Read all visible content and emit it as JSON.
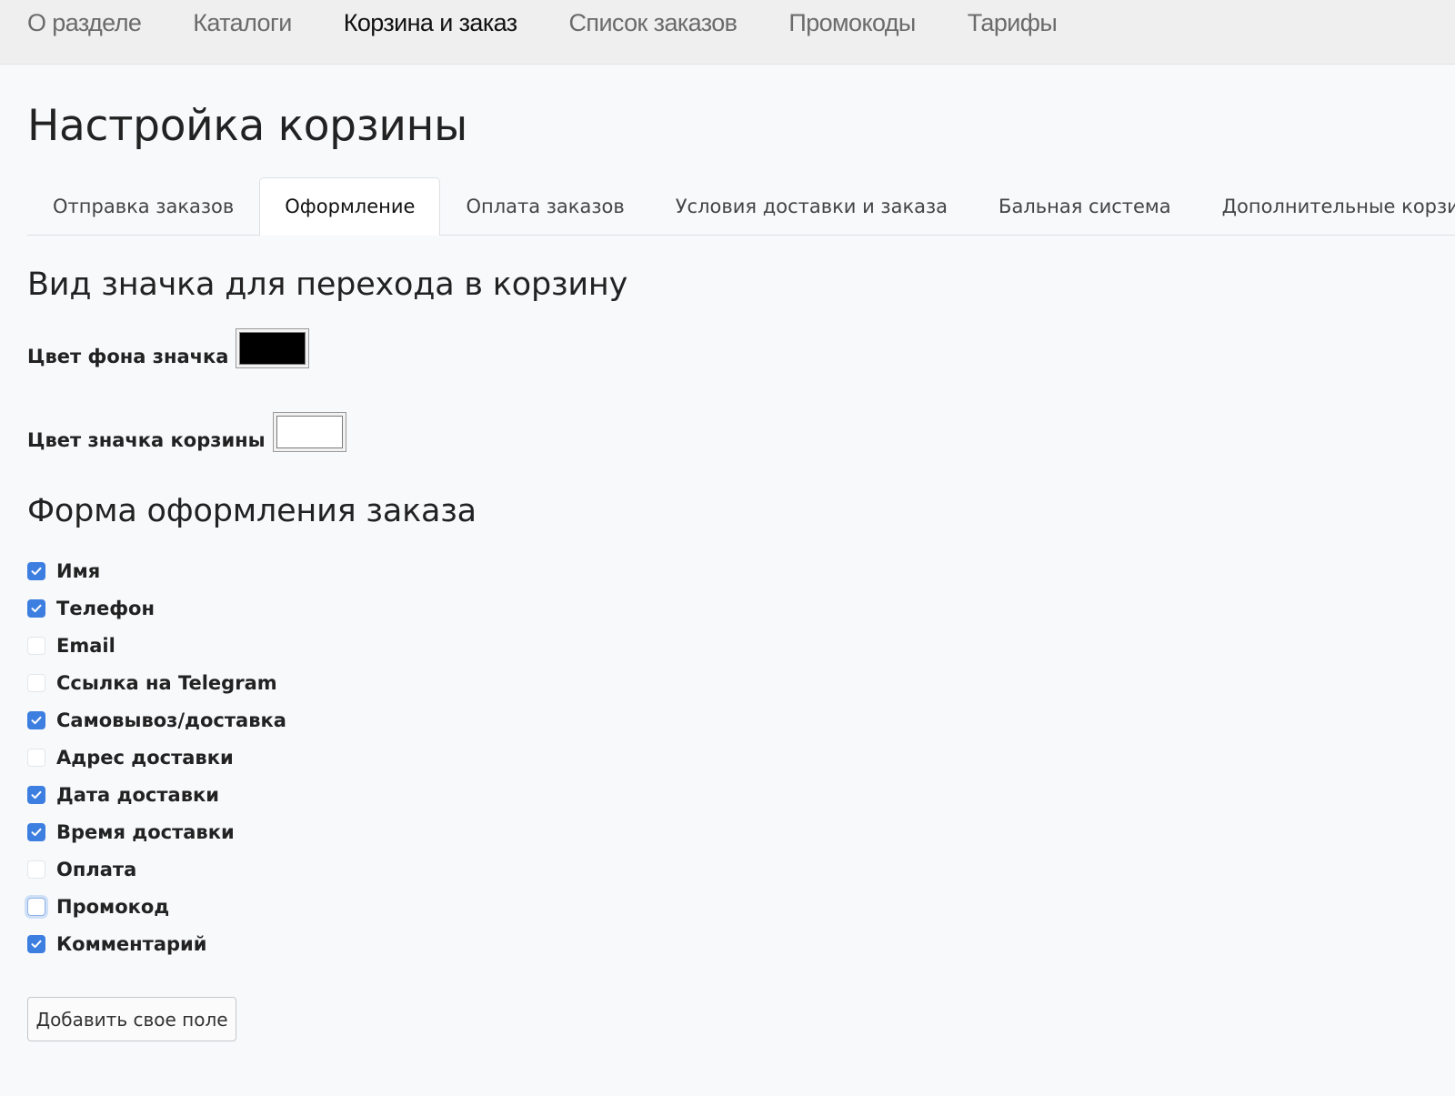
{
  "topnav": {
    "items": [
      {
        "label": "О разделе",
        "active": false
      },
      {
        "label": "Каталоги",
        "active": false
      },
      {
        "label": "Корзина и заказ",
        "active": true
      },
      {
        "label": "Список заказов",
        "active": false
      },
      {
        "label": "Промокоды",
        "active": false
      },
      {
        "label": "Тарифы",
        "active": false
      }
    ]
  },
  "page": {
    "title": "Настройка корзины"
  },
  "tabs": [
    {
      "label": "Отправка заказов",
      "active": false
    },
    {
      "label": "Оформление",
      "active": true
    },
    {
      "label": "Оплата заказов",
      "active": false
    },
    {
      "label": "Условия доставки и заказа",
      "active": false
    },
    {
      "label": "Бальная система",
      "active": false
    },
    {
      "label": "Дополнительные корзины",
      "active": false
    }
  ],
  "icon_section": {
    "title": "Вид значка для перехода в корзину",
    "bg_color": {
      "label": "Цвет фона значка",
      "value": "#000000"
    },
    "icon_color": {
      "label": "Цвет значка корзины",
      "value": "#ffffff"
    }
  },
  "form_section": {
    "title": "Форма оформления заказа",
    "fields": [
      {
        "label": "Имя",
        "checked": true
      },
      {
        "label": "Телефон",
        "checked": true
      },
      {
        "label": "Email",
        "checked": false
      },
      {
        "label": "Ссылка на Telegram",
        "checked": false
      },
      {
        "label": "Самовывоз/доставка",
        "checked": true
      },
      {
        "label": "Адрес доставки",
        "checked": false
      },
      {
        "label": "Дата доставки",
        "checked": true
      },
      {
        "label": "Время доставки",
        "checked": true
      },
      {
        "label": "Оплата",
        "checked": false
      },
      {
        "label": "Промокод",
        "checked": false,
        "focused": true
      },
      {
        "label": "Комментарий",
        "checked": true
      }
    ],
    "add_button": "Добавить свое поле"
  },
  "colors": {
    "accent": "#3d7fe0",
    "background": "#f8f9fb",
    "topbar": "#efefef"
  }
}
